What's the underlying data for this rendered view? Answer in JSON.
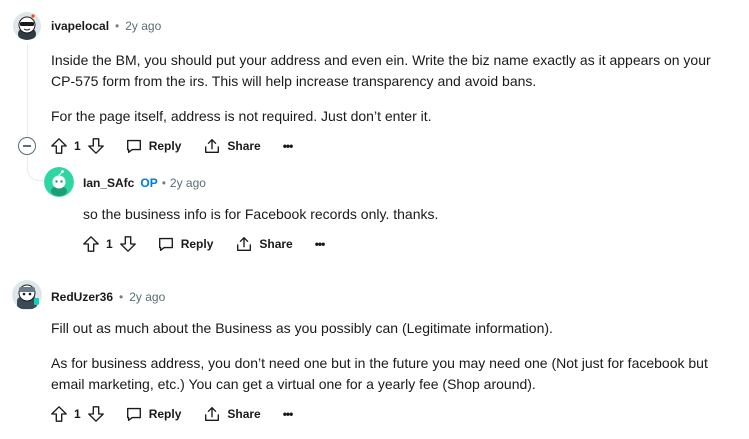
{
  "comments": [
    {
      "author": "ivapelocal",
      "time": "2y ago",
      "paragraphs": [
        "Inside the BM, you should put your address and even ein. Write the biz name exactly as it appears on your CP-575 form from the irs. This will help increase transparency and avoid bans.",
        "For the page itself, address is not required. Just don’t enter it."
      ],
      "votes": "1",
      "reply_label": "Reply",
      "share_label": "Share",
      "more_label": "•••"
    },
    {
      "author": "Ian_SAfc",
      "op_badge": "OP",
      "time": "2y ago",
      "paragraphs": [
        "so the business info is for Facebook records only. thanks."
      ],
      "votes": "1",
      "reply_label": "Reply",
      "share_label": "Share",
      "more_label": "•••"
    },
    {
      "author": "RedUzer36",
      "time": "2y ago",
      "paragraphs": [
        "Fill out as much about the Business as you possibly can (Legitimate information).",
        "As for business address, you don’t need one but in the future you may need one (Not just for facebook but email marketing, etc.) You can get a virtual one for a yearly fee (Shop around)."
      ],
      "votes": "1",
      "reply_label": "Reply",
      "share_label": "Share",
      "more_label": "•••"
    }
  ],
  "dot_separator": "•",
  "icons": {
    "upvote": "upvote-icon",
    "downvote": "downvote-icon",
    "reply": "reply-icon",
    "share": "share-icon",
    "collapse": "collapse-icon"
  },
  "colors": {
    "op_badge": "#0079d3",
    "meta_gray": "#576f76",
    "thread_line": "#e5ebee"
  }
}
